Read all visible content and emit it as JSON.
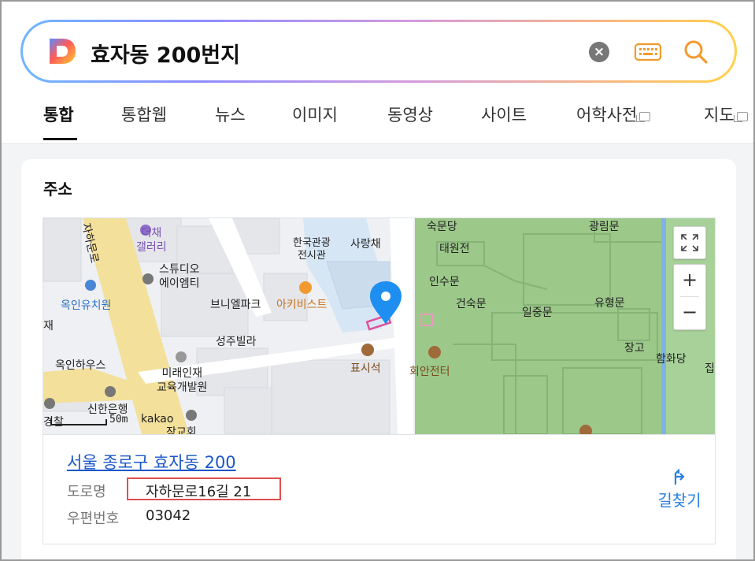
{
  "search": {
    "query": "효자동 200번지",
    "logo_letter": "D"
  },
  "tabs": [
    {
      "label": "통합",
      "active": true
    },
    {
      "label": "통합웹"
    },
    {
      "label": "뉴스"
    },
    {
      "label": "이미지"
    },
    {
      "label": "동영상"
    },
    {
      "label": "사이트"
    },
    {
      "label": "어학사전",
      "external": true
    },
    {
      "label": "지도",
      "external": true
    }
  ],
  "card": {
    "title": "주소",
    "address_link": "서울 종로구 효자동 200",
    "road_label": "도로명",
    "road_value": "자하문로16길 21",
    "postal_label": "우편번호",
    "postal_value": "03042",
    "directions_label": "길찾기"
  },
  "map": {
    "scale_text": "50m",
    "brand": "kakao",
    "zoom_in": "+",
    "zoom_out": "−",
    "labels": {
      "cafe": "더채\n갤러리",
      "studio": "스튜디오\n에이엠티",
      "kindergarten": "옥인유치원",
      "brunel": "브니엘파크",
      "archivist": "아키비스트",
      "seongju": "성주빌라",
      "okin_house": "옥인하우스",
      "future": "미래인재\n교육개발원",
      "shinhan": "신한은행",
      "police": "경찰",
      "church": "장교회",
      "craft": "한국관광\n전시관",
      "sarang": "사랑채",
      "pyosi": "표시석",
      "hoean": "회안전터",
      "sukmun": "숙문당",
      "gwanglim": "광림문",
      "taewon": "태원전",
      "insu": "인수문",
      "geonsuk": "건숙문",
      "iljung": "일중문",
      "yuhyeong": "유형문",
      "janggo": "장고",
      "hamhwa": "함화당",
      "jae_road": "자하문로",
      "jae": "재",
      "jip": "집"
    }
  },
  "colors": {
    "link": "#1a57c8",
    "directions": "#2a7fe0",
    "highlight": "#e05050",
    "park": "#9cc88a",
    "road_yellow": "#f3e09a"
  }
}
